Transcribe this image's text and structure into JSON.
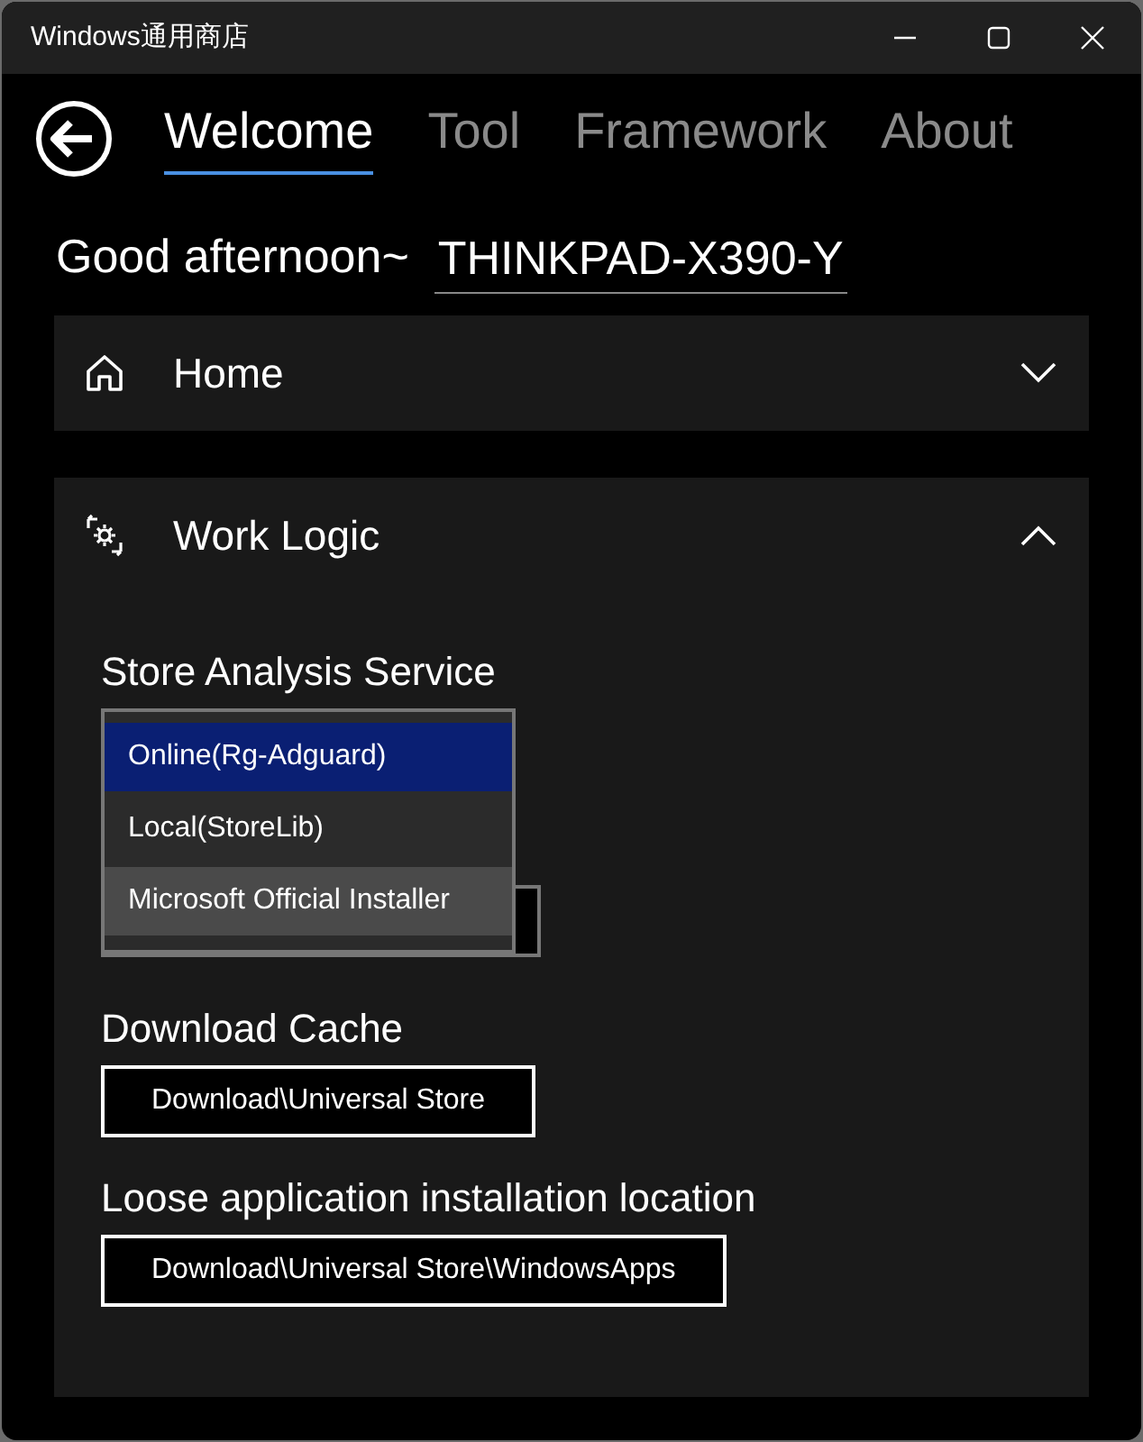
{
  "window": {
    "title": "Windows通用商店"
  },
  "tabs": [
    {
      "label": "Welcome",
      "selected": true
    },
    {
      "label": "Tool",
      "selected": false
    },
    {
      "label": "Framework",
      "selected": false
    },
    {
      "label": "About",
      "selected": false
    }
  ],
  "greeting": {
    "label": "Good afternoon~",
    "value": "THINKPAD-X390-Y"
  },
  "sections": [
    {
      "kind": "home",
      "title": "Home",
      "expanded": false
    },
    {
      "kind": "logic",
      "title": "Work Logic",
      "expanded": true,
      "settings": [
        {
          "kind": "dropdown",
          "label": "Store Analysis Service",
          "options": [
            {
              "label": "Online(Rg-Adguard)",
              "selected": true,
              "highlighted": false
            },
            {
              "label": "Local(StoreLib)",
              "selected": false,
              "highlighted": false
            },
            {
              "label": "Microsoft Official Installer",
              "selected": false,
              "highlighted": true
            }
          ]
        },
        {
          "kind": "path",
          "label": "Download Cache",
          "value": "Download\\Universal Store"
        },
        {
          "kind": "path",
          "label": "Loose application installation location",
          "value": "Download\\Universal Store\\WindowsApps"
        }
      ]
    }
  ]
}
